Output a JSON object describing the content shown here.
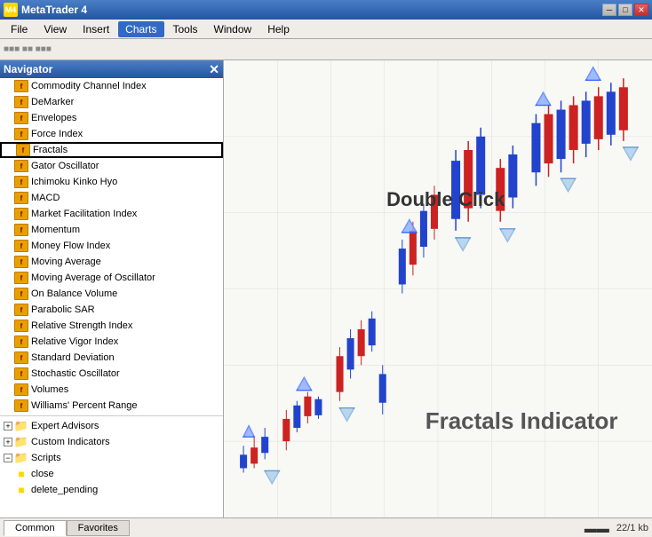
{
  "titleBar": {
    "appName": "MetaTrader 4",
    "iconSymbol": "M",
    "controls": {
      "minimize": "─",
      "maximize": "□",
      "close": "✕"
    }
  },
  "menuBar": {
    "items": [
      "File",
      "View",
      "Insert",
      "Charts",
      "Tools",
      "Window",
      "Help"
    ],
    "activeIndex": 3
  },
  "navigator": {
    "title": "Navigator",
    "closeBtn": "✕",
    "sections": {
      "indicators": [
        "Commodity Channel Index",
        "DeMarker",
        "Envelopes",
        "Force Index",
        "Fractals",
        "Gator Oscillator",
        "Ichimoku Kinko Hyo",
        "MACD",
        "Market Facilitation Index",
        "Momentum",
        "Money Flow Index",
        "Moving Average",
        "Moving Average of Oscillator",
        "On Balance Volume",
        "Parabolic SAR",
        "Relative Strength Index",
        "Relative Vigor Index",
        "Standard Deviation",
        "Stochastic Oscillator",
        "Volumes",
        "Williams' Percent Range"
      ],
      "expertAdvisors": "Expert Advisors",
      "customIndicators": "Custom Indicators",
      "scripts": {
        "label": "Scripts",
        "items": [
          "close",
          "delete_pending"
        ]
      }
    }
  },
  "chart": {
    "doubleClickLabel": "Double Click",
    "fractalsLabel": "Fractals Indicator"
  },
  "bottomBar": {
    "tabs": [
      "Common",
      "Favorites"
    ],
    "activeTab": "Common",
    "statusRight": "22/1 kb"
  }
}
